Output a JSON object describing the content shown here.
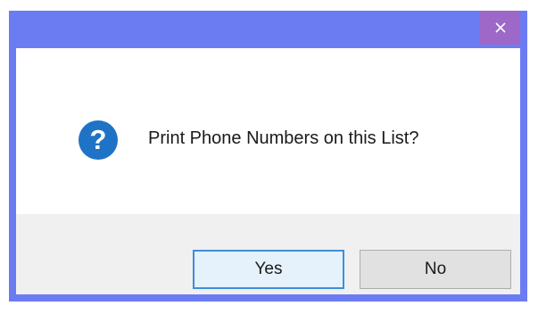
{
  "window": {
    "title": "",
    "close_icon": "close-icon",
    "accent_color": "#6b7cf2",
    "close_hover_color": "#9d68c7"
  },
  "dialog": {
    "icon": "question-icon",
    "icon_color": "#1f73c6",
    "message": "Print Phone Numbers on this List?"
  },
  "buttons": {
    "yes_label": "Yes",
    "no_label": "No",
    "default": "Yes"
  }
}
